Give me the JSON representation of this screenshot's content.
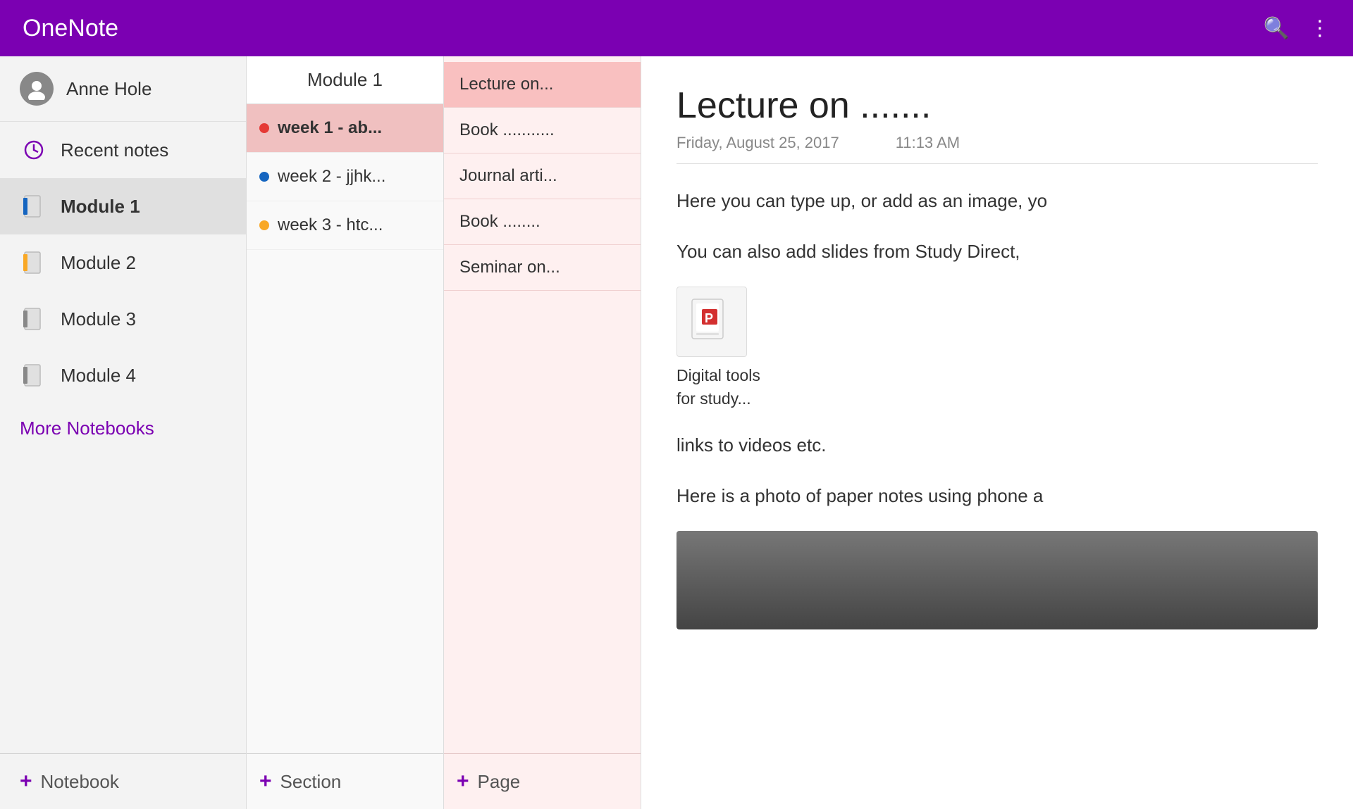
{
  "app": {
    "title": "OneNote"
  },
  "topbar": {
    "title": "OneNote",
    "search_icon": "🔍",
    "more_icon": "⋮"
  },
  "sidebar": {
    "user_name": "Anne Hole",
    "recent_notes_label": "Recent notes",
    "notebooks": [
      {
        "id": "module1",
        "label": "Module 1",
        "color": "#1565C0",
        "active": true
      },
      {
        "id": "module2",
        "label": "Module 2",
        "color": "#F9A825"
      },
      {
        "id": "module3",
        "label": "Module 3",
        "color": ""
      },
      {
        "id": "module4",
        "label": "Module 4",
        "color": ""
      }
    ],
    "more_notebooks_label": "More Notebooks",
    "add_notebook_label": "Notebook"
  },
  "sections": {
    "header": "Module 1",
    "items": [
      {
        "id": "week1",
        "label": "week 1 - ab...",
        "color": "#E53935",
        "active": true
      },
      {
        "id": "week2",
        "label": "week 2 - jjhk...",
        "color": "#1565C0"
      },
      {
        "id": "week3",
        "label": "week 3 - htc...",
        "color": "#F9A825"
      }
    ],
    "add_section_label": "Section"
  },
  "pages": {
    "items": [
      {
        "id": "lecture",
        "label": "Lecture on...",
        "active": true
      },
      {
        "id": "book1",
        "label": "Book ..........."
      },
      {
        "id": "journal",
        "label": "Journal arti..."
      },
      {
        "id": "book2",
        "label": "Book ........"
      },
      {
        "id": "seminar",
        "label": "Seminar on..."
      }
    ],
    "add_page_label": "Page"
  },
  "note": {
    "title": "Lecture on .......",
    "date": "Friday, August 25, 2017",
    "time": "11:13 AM",
    "paragraphs": [
      "Here you can type up, or add as an image, yo",
      "You can also add slides from Study Direct,",
      "links to videos etc.",
      "Here is a photo of paper notes using phone a"
    ],
    "attachment": {
      "label": "Digital tools\n for study...",
      "icon": "📊"
    }
  }
}
